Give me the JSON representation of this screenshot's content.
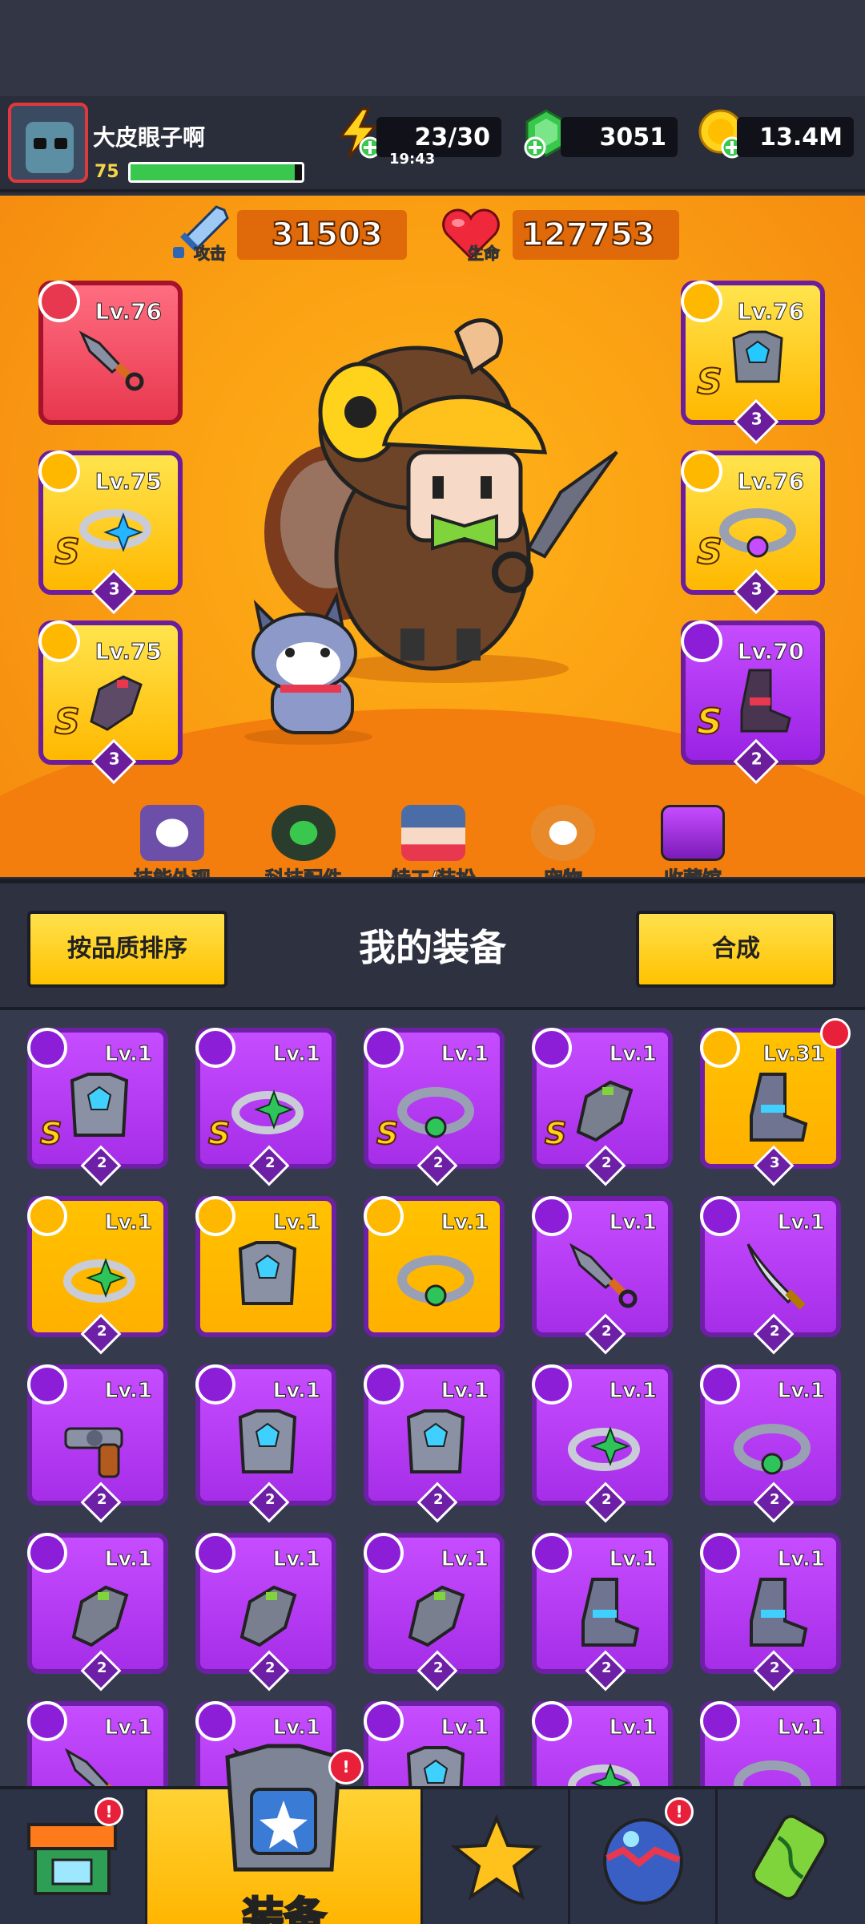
{
  "player": {
    "name": "大皮眼子啊",
    "level": "75",
    "xp_fraction": 0.96
  },
  "resources": {
    "energy": "23/30",
    "energy_timer": "19:43",
    "gems": "3051",
    "coins": "13.4M"
  },
  "stats": {
    "attack_label": "攻击",
    "attack_value": "31503",
    "hp_label": "生命",
    "hp_value": "127753"
  },
  "equipped": {
    "weapon": {
      "lv": "Lv.76",
      "icon": "kunai-icon"
    },
    "ring": {
      "lv": "Lv.75",
      "rank": "S",
      "stars": "3",
      "icon": "ring-icon"
    },
    "glove": {
      "lv": "Lv.75",
      "rank": "S",
      "stars": "3",
      "icon": "glove-icon"
    },
    "armor": {
      "lv": "Lv.76",
      "rank": "S",
      "stars": "3",
      "icon": "armor-icon"
    },
    "belt": {
      "lv": "Lv.76",
      "rank": "S",
      "stars": "3",
      "icon": "belt-icon"
    },
    "boots": {
      "lv": "Lv.70",
      "rank": "S",
      "stars": "2",
      "icon": "boots-icon"
    }
  },
  "menu_tabs": [
    {
      "label": "技能外观",
      "icon": "skill-skin-icon"
    },
    {
      "label": "科技配件",
      "icon": "tech-parts-icon"
    },
    {
      "label": "特工/装扮",
      "icon": "agent-costume-icon"
    },
    {
      "label": "宠物",
      "icon": "pet-icon"
    },
    {
      "label": "收藏馆",
      "icon": "collection-icon"
    }
  ],
  "bag": {
    "sort_label": "按品质排序",
    "title": "我的装备",
    "merge_label": "合成",
    "items": [
      {
        "lv": "Lv.1",
        "rank": "S",
        "stars": "2",
        "bg": "purple",
        "type": "armor-icon"
      },
      {
        "lv": "Lv.1",
        "rank": "S",
        "stars": "2",
        "bg": "purple",
        "type": "ring-icon"
      },
      {
        "lv": "Lv.1",
        "rank": "S",
        "stars": "2",
        "bg": "purple",
        "type": "belt-icon"
      },
      {
        "lv": "Lv.1",
        "rank": "S",
        "stars": "2",
        "bg": "purple",
        "type": "glove-icon"
      },
      {
        "lv": "Lv.31",
        "rank": "",
        "stars": "3",
        "bg": "gold",
        "type": "boots-icon",
        "alert": true
      },
      {
        "lv": "Lv.1",
        "rank": "",
        "stars": "2",
        "bg": "gold",
        "type": "ring-icon"
      },
      {
        "lv": "Lv.1",
        "rank": "",
        "stars": "",
        "bg": "gold",
        "type": "armor-icon"
      },
      {
        "lv": "Lv.1",
        "rank": "",
        "stars": "",
        "bg": "gold",
        "type": "belt-icon"
      },
      {
        "lv": "Lv.1",
        "rank": "",
        "stars": "2",
        "bg": "purple",
        "type": "kunai-icon"
      },
      {
        "lv": "Lv.1",
        "rank": "",
        "stars": "2",
        "bg": "purple",
        "type": "sword-icon"
      },
      {
        "lv": "Lv.1",
        "rank": "",
        "stars": "2",
        "bg": "purple",
        "type": "revolver-icon"
      },
      {
        "lv": "Lv.1",
        "rank": "",
        "stars": "2",
        "bg": "purple",
        "type": "armor-icon"
      },
      {
        "lv": "Lv.1",
        "rank": "",
        "stars": "2",
        "bg": "purple",
        "type": "armor-icon"
      },
      {
        "lv": "Lv.1",
        "rank": "",
        "stars": "2",
        "bg": "purple",
        "type": "ring-icon"
      },
      {
        "lv": "Lv.1",
        "rank": "",
        "stars": "2",
        "bg": "purple",
        "type": "belt-icon"
      },
      {
        "lv": "Lv.1",
        "rank": "",
        "stars": "2",
        "bg": "purple",
        "type": "glove-icon"
      },
      {
        "lv": "Lv.1",
        "rank": "",
        "stars": "2",
        "bg": "purple",
        "type": "glove-icon"
      },
      {
        "lv": "Lv.1",
        "rank": "",
        "stars": "2",
        "bg": "purple",
        "type": "glove-icon"
      },
      {
        "lv": "Lv.1",
        "rank": "",
        "stars": "2",
        "bg": "purple",
        "type": "boots-icon"
      },
      {
        "lv": "Lv.1",
        "rank": "",
        "stars": "2",
        "bg": "purple",
        "type": "boots-icon"
      },
      {
        "lv": "Lv.1",
        "rank": "",
        "stars": "",
        "bg": "purple",
        "type": "kunai-icon"
      },
      {
        "lv": "Lv.1",
        "rank": "",
        "stars": "",
        "bg": "purple",
        "type": "kunai-icon"
      },
      {
        "lv": "Lv.1",
        "rank": "",
        "stars": "",
        "bg": "purple",
        "type": "armor-icon"
      },
      {
        "lv": "Lv.1",
        "rank": "",
        "stars": "",
        "bg": "purple",
        "type": "ring-icon"
      },
      {
        "lv": "Lv.1",
        "rank": "",
        "stars": "",
        "bg": "purple",
        "type": "belt-icon"
      }
    ]
  },
  "nav": {
    "shop_icon": "shop-icon",
    "equip_label": "装备",
    "equip_icon": "equipment-icon",
    "battle_icon": "battle-star-icon",
    "egg_icon": "egg-icon",
    "lab_icon": "dna-icon"
  },
  "colors": {
    "orange_bg": "#fba213",
    "gold_card": "#ffc200",
    "purple_card": "#a62ee8",
    "red_card": "#e8384f",
    "alert_red": "#e8203a"
  }
}
